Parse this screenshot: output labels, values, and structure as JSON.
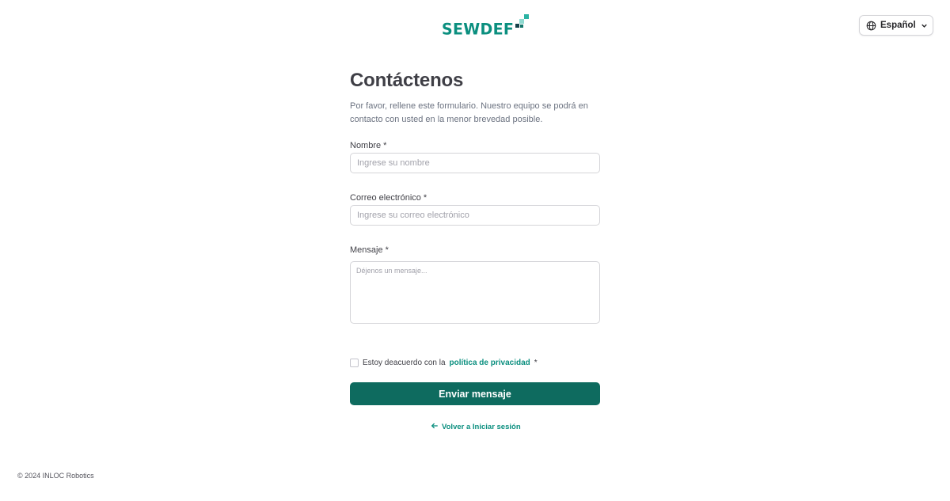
{
  "brand": {
    "logo_text": "SEWDEF"
  },
  "header": {
    "language": {
      "label": "Español",
      "icon": "globe-icon",
      "chevron": "chevron-down-icon"
    }
  },
  "form": {
    "title": "Contáctenos",
    "subtitle": "Por favor, rellene este formulario. Nuestro equipo se podrá en contacto con usted en la menor brevedad posible.",
    "fields": {
      "name": {
        "label": "Nombre *",
        "placeholder": "Ingrese su nombre",
        "value": ""
      },
      "email": {
        "label": "Correo electrónico *",
        "placeholder": "Ingrese su correo electrónico",
        "value": ""
      },
      "message": {
        "label": "Mensaje *",
        "placeholder": "Déjenos un mensaje...",
        "value": ""
      }
    },
    "agreement": {
      "prefix": "Estoy deacuerdo con la",
      "link_text": "política de privacidad",
      "suffix": "*",
      "checked": false
    },
    "submit_label": "Enviar mensaje",
    "back_label": "Volver a Iniciar sesión"
  },
  "footer": {
    "copyright": "© 2024 INLOC Robotics"
  },
  "colors": {
    "brand": "#0b8f7f",
    "button": "#0e6b5f",
    "text": "#3f3f46",
    "muted": "#6b7280"
  }
}
